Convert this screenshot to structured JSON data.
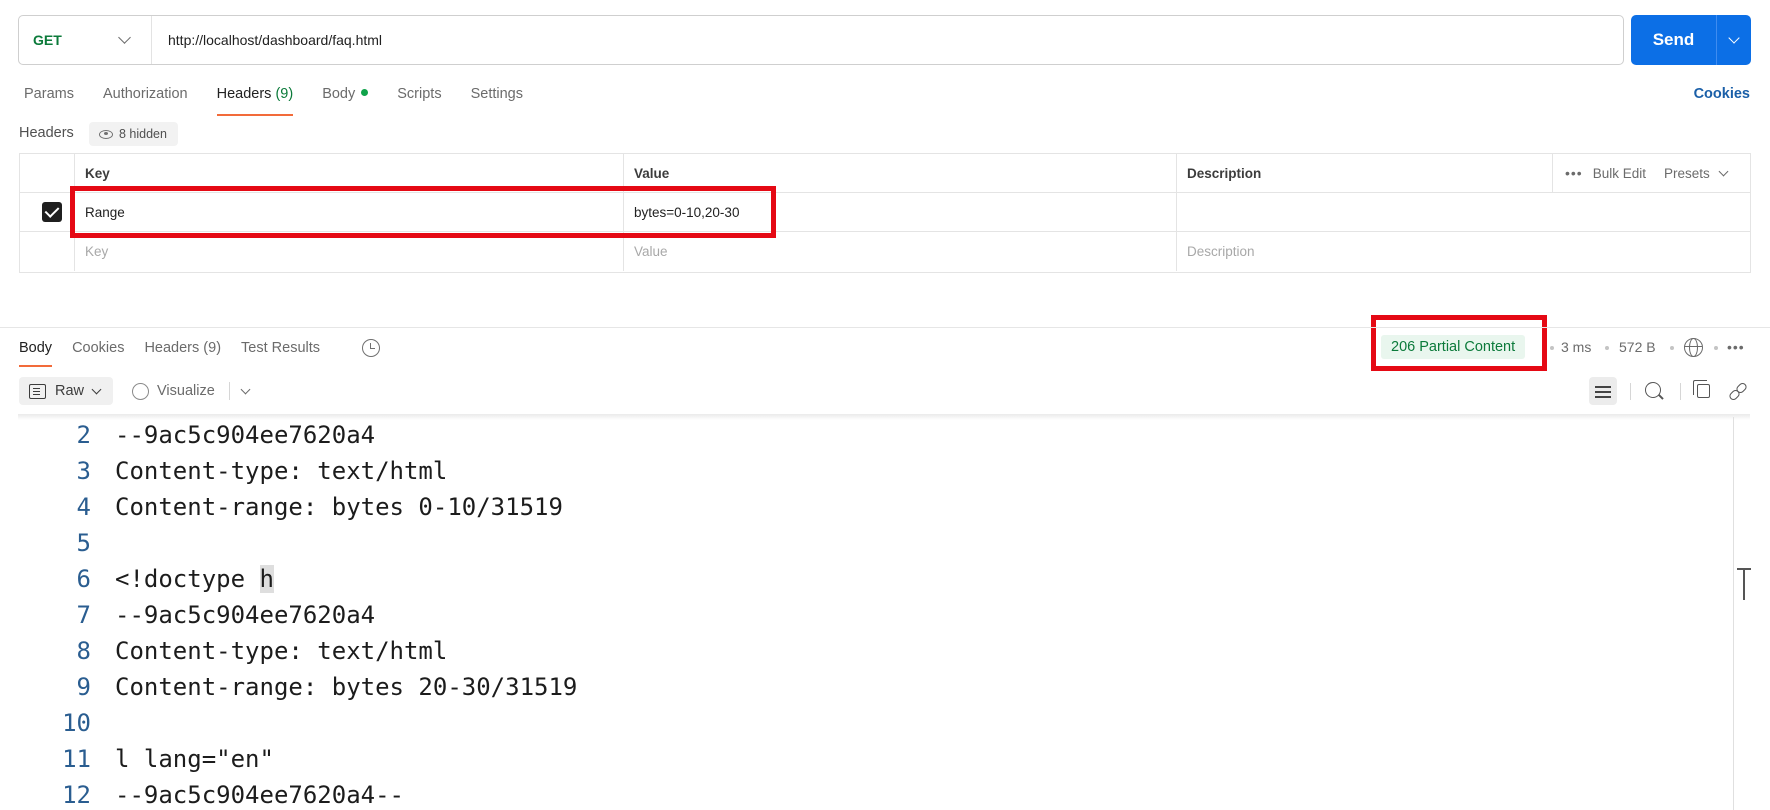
{
  "request": {
    "method": "GET",
    "url": "http://localhost/dashboard/faq.html",
    "send_label": "Send"
  },
  "request_tabs": [
    {
      "label": "Params"
    },
    {
      "label": "Authorization"
    },
    {
      "label": "Headers",
      "count": "(9)"
    },
    {
      "label": "Body"
    },
    {
      "label": "Scripts"
    },
    {
      "label": "Settings"
    }
  ],
  "cookies_link": "Cookies",
  "headers_section": {
    "title": "Headers",
    "hidden_label": "8 hidden",
    "columns": {
      "key": "Key",
      "value": "Value",
      "description": "Description",
      "bulk_edit": "Bulk Edit",
      "presets": "Presets"
    },
    "rows": [
      {
        "key": "Range",
        "value": "bytes=0-10,20-30",
        "description": ""
      }
    ],
    "placeholder": {
      "key": "Key",
      "value": "Value",
      "description": "Description"
    }
  },
  "response_tabs": [
    {
      "label": "Body"
    },
    {
      "label": "Cookies"
    },
    {
      "label": "Headers",
      "count": "(9)"
    },
    {
      "label": "Test Results"
    }
  ],
  "response_meta": {
    "status": "206 Partial Content",
    "time": "3 ms",
    "size": "572 B"
  },
  "body_toolbar": {
    "format": "Raw",
    "visualize": "Visualize"
  },
  "code_lines": [
    {
      "n": "2",
      "text": "--9ac5c904ee7620a4"
    },
    {
      "n": "3",
      "text": "Content-type: text/html"
    },
    {
      "n": "4",
      "text": "Content-range: bytes 0-10/31519"
    },
    {
      "n": "5",
      "text": ""
    },
    {
      "n": "6",
      "text_pre": "<!doctype ",
      "text_hl": "h"
    },
    {
      "n": "7",
      "text": "--9ac5c904ee7620a4"
    },
    {
      "n": "8",
      "text": "Content-type: text/html"
    },
    {
      "n": "9",
      "text": "Content-range: bytes 20-30/31519"
    },
    {
      "n": "10",
      "text": ""
    },
    {
      "n": "11",
      "text": "l lang=\"en\""
    },
    {
      "n": "12",
      "text": "--9ac5c904ee7620a4--"
    }
  ],
  "colors": {
    "accent": "#0c6fe6",
    "tab_underline": "#f26b3a",
    "method": "#0b7a3a",
    "status_ok": "#0b7a3a",
    "annotation": "#e50914"
  }
}
